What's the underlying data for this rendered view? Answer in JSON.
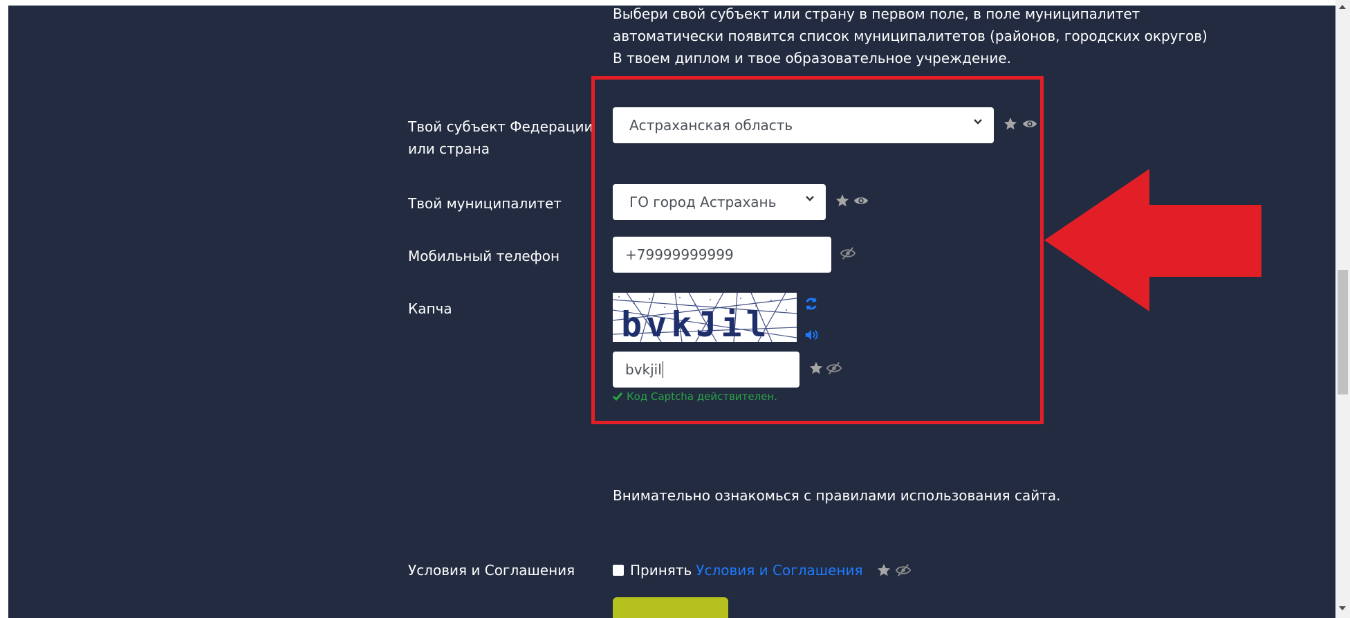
{
  "intro": {
    "line1": "Выбери свой субъект или страну в первом поле, в поле муниципалитет",
    "line2": "автоматически появится список муниципалитетов (районов, городских округов)",
    "line3": "В твоем диплом и твое образовательное учреждение."
  },
  "region": {
    "label_line1": "Твой субъект Федерации",
    "label_line2": "или страна",
    "value": "Астраханская область"
  },
  "municipality": {
    "label": "Твой муниципалитет",
    "value": "ГО город Астрахань"
  },
  "phone": {
    "label": "Мобильный телефон",
    "value": "+79999999999"
  },
  "captcha": {
    "label": "Капча",
    "image_text": "bvkJil",
    "value": "bvkjil",
    "valid_message": "Код Captcha действителен."
  },
  "rules_text": "Внимательно ознакомься с правилами использования сайта.",
  "terms": {
    "label": "Условия и Соглашения",
    "accept_text": "Принять",
    "link_text": "Условия и Соглашения"
  },
  "colors": {
    "background": "#222b40",
    "highlight": "#e21f26",
    "link": "#1e7bff",
    "valid": "#28a745",
    "submit": "#b5c11f"
  }
}
